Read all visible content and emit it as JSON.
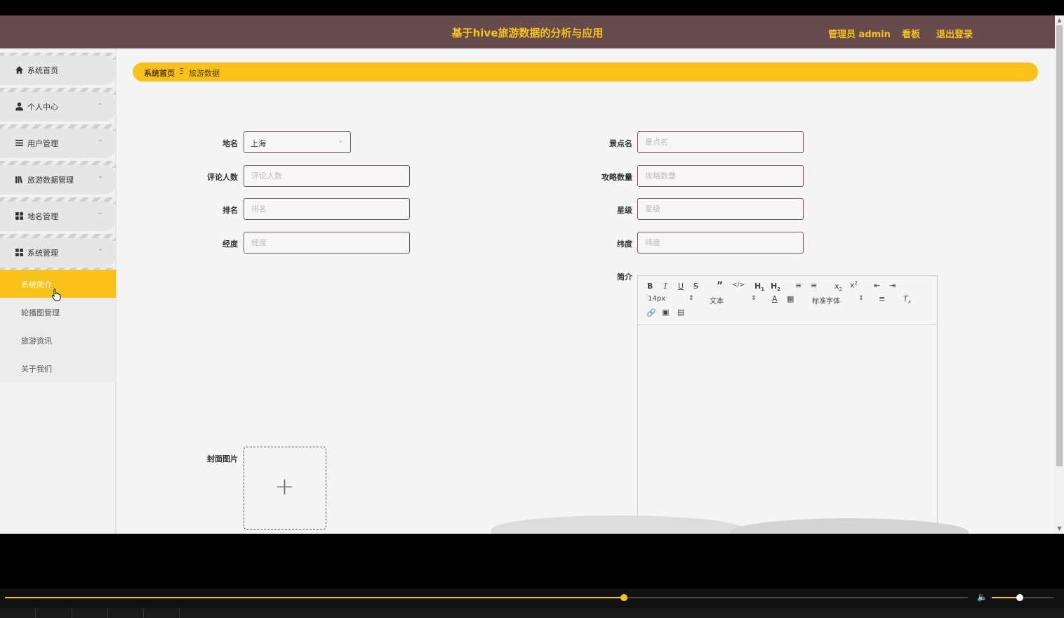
{
  "header": {
    "title": "基于hive旅游数据的分析与应用",
    "admin": "管理员 admin",
    "board": "看板",
    "logout": "退出登录"
  },
  "sidebar": {
    "items": [
      {
        "label": "系统首页",
        "icon": "home-icon"
      },
      {
        "label": "个人中心",
        "icon": "user-icon"
      },
      {
        "label": "用户管理",
        "icon": "list-icon"
      },
      {
        "label": "旅游数据管理",
        "icon": "books-icon"
      },
      {
        "label": "地名管理",
        "icon": "grid-icon"
      },
      {
        "label": "系统管理",
        "icon": "grid-icon"
      }
    ],
    "sub_items": [
      {
        "label": "系统简介",
        "active": true
      },
      {
        "label": "轮播图管理"
      },
      {
        "label": "旅游资讯"
      },
      {
        "label": "关于我们"
      }
    ]
  },
  "breadcrumb": {
    "home": "系统首页",
    "separator": "Ξ",
    "current": "旅游数据"
  },
  "form": {
    "place": {
      "label": "地名",
      "value": "上海"
    },
    "attraction": {
      "label": "景点名",
      "placeholder": "景点名"
    },
    "reviews": {
      "label": "评论人数",
      "placeholder": "评论人数"
    },
    "guides": {
      "label": "攻略数量",
      "placeholder": "攻略数量"
    },
    "rank": {
      "label": "排名",
      "placeholder": "排名"
    },
    "star": {
      "label": "星级",
      "placeholder": "星级"
    },
    "longitude": {
      "label": "经度",
      "placeholder": "经度"
    },
    "latitude": {
      "label": "纬度",
      "placeholder": "纬度"
    },
    "intro": {
      "label": "简介"
    },
    "cover": {
      "label": "封面图片"
    }
  },
  "editor": {
    "font_size": "14px",
    "header_select": "文本",
    "font_family": "标准字体"
  },
  "player": {
    "progress": 0.6425,
    "volume": 0.45
  },
  "colors": {
    "accent": "#f9c21a",
    "header_bg": "#654b4b"
  }
}
